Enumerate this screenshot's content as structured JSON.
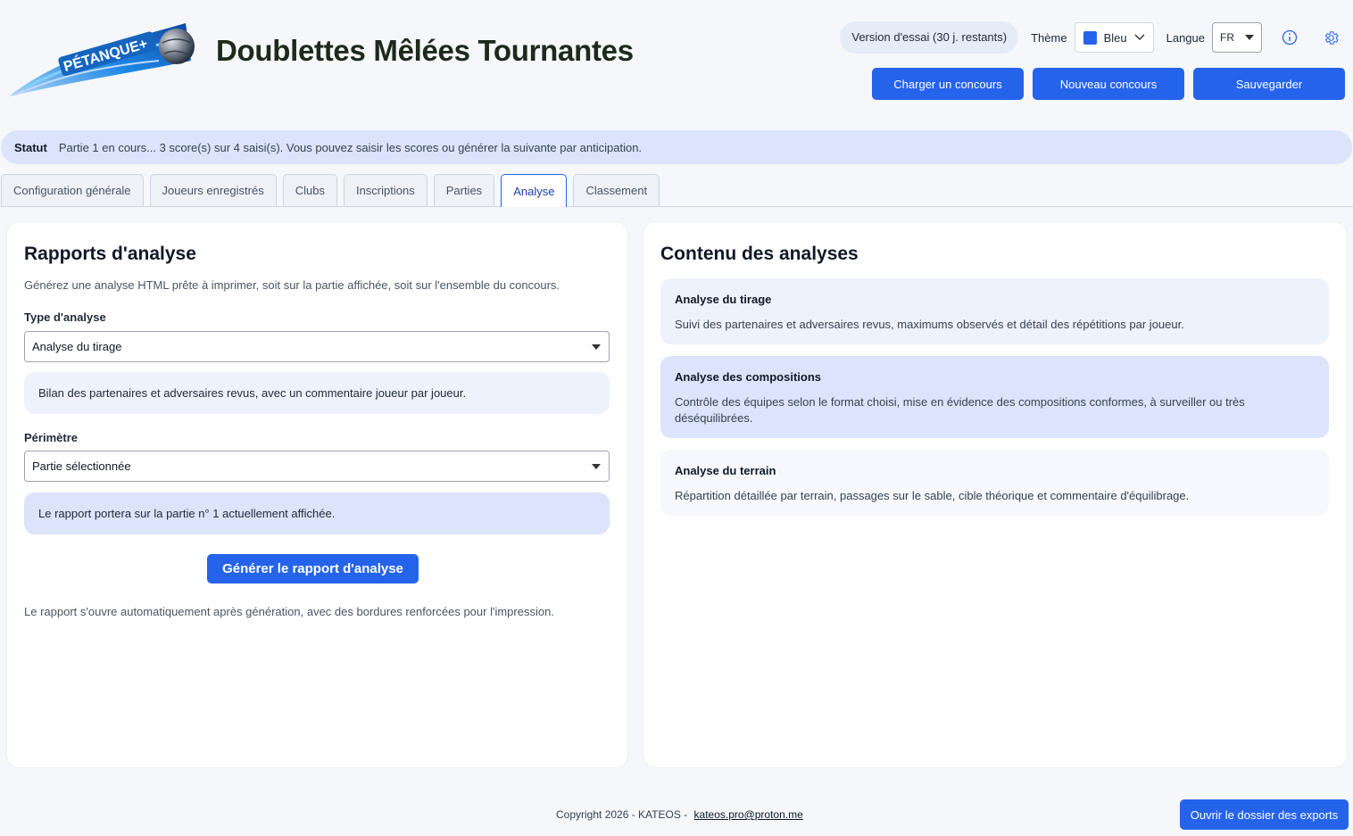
{
  "header": {
    "logo_text": "PÉTANQUE+",
    "title": "Doublettes Mêlées Tournantes",
    "trial_badge": "Version d'essai (30 j. restants)",
    "theme_label": "Thème",
    "theme_value": "Bleu",
    "theme_color": "#2563eb",
    "lang_label": "Langue",
    "lang_value": "FR",
    "buttons": {
      "load": "Charger un concours",
      "new": "Nouveau concours",
      "save": "Sauvegarder"
    }
  },
  "status": {
    "label": "Statut",
    "text": "Partie 1 en cours... 3 score(s) sur 4 saisi(s). Vous pouvez saisir les scores ou générer la suivante par anticipation."
  },
  "tabs": [
    {
      "label": "Configuration générale",
      "active": false
    },
    {
      "label": "Joueurs enregistrés",
      "active": false
    },
    {
      "label": "Clubs",
      "active": false
    },
    {
      "label": "Inscriptions",
      "active": false
    },
    {
      "label": "Parties",
      "active": false
    },
    {
      "label": "Analyse",
      "active": true
    },
    {
      "label": "Classement",
      "active": false
    }
  ],
  "reports": {
    "title": "Rapports d'analyse",
    "description": "Générez une analyse HTML prête à imprimer, soit sur la partie affichée, soit sur l'ensemble du concours.",
    "type_label": "Type d'analyse",
    "type_value": "Analyse du tirage",
    "type_hint": "Bilan des partenaires et adversaires revus, avec un commentaire joueur par joueur.",
    "scope_label": "Périmètre",
    "scope_value": "Partie sélectionnée",
    "scope_hint": "Le rapport portera sur la partie n° 1 actuellement affichée.",
    "generate_button": "Générer le rapport d'analyse",
    "footnote": "Le rapport s'ouvre automatiquement après génération, avec des bordures renforcées pour l'impression."
  },
  "contents": {
    "title": "Contenu des analyses",
    "items": [
      {
        "title": "Analyse du tirage",
        "text": "Suivi des partenaires et adversaires revus, maximums observés et détail des répétitions par joueur."
      },
      {
        "title": "Analyse des compositions",
        "text": "Contrôle des équipes selon le format choisi, mise en évidence des compositions conformes, à surveiller ou très déséquilibrées."
      },
      {
        "title": "Analyse du terrain",
        "text": "Répartition détaillée par terrain, passages sur le sable, cible théorique et commentaire d'équilibrage."
      }
    ]
  },
  "footer": {
    "copyright": "Copyright 2026 - KATEOS - ",
    "email": "kateos.pro@proton.me",
    "exports_button": "Ouvrir le dossier des exports"
  }
}
